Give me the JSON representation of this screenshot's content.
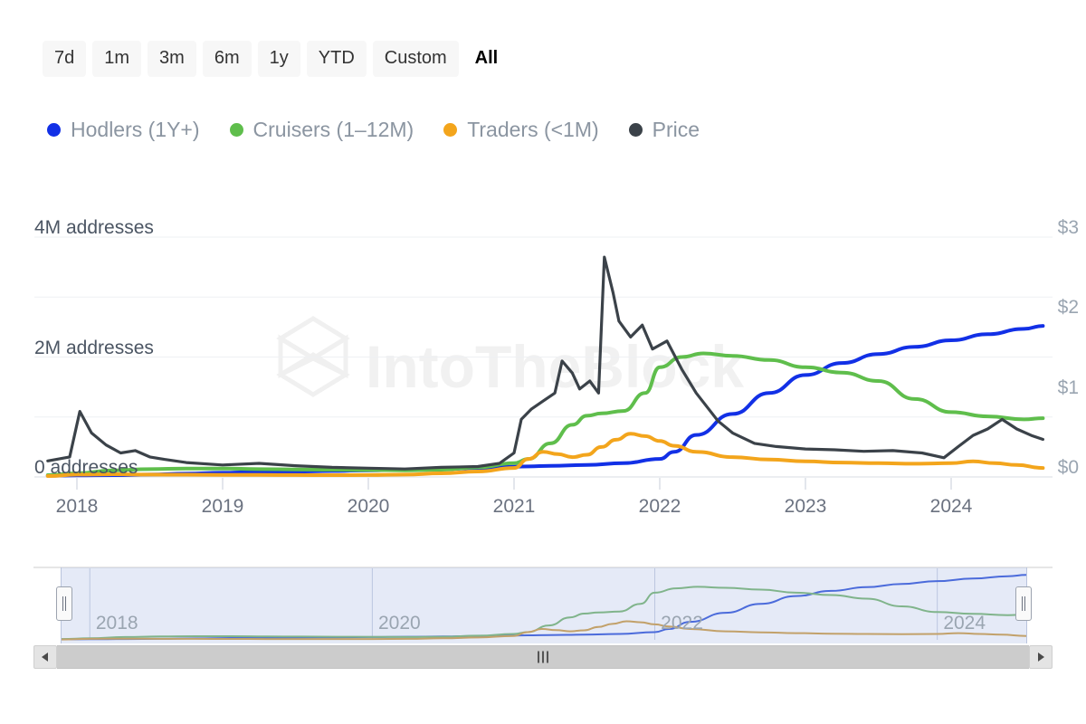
{
  "range_selector": {
    "buttons": [
      {
        "label": "7d",
        "selected": false
      },
      {
        "label": "1m",
        "selected": false
      },
      {
        "label": "3m",
        "selected": false
      },
      {
        "label": "6m",
        "selected": false
      },
      {
        "label": "1y",
        "selected": false
      },
      {
        "label": "YTD",
        "selected": false
      },
      {
        "label": "Custom",
        "selected": false
      },
      {
        "label": "All",
        "selected": true
      }
    ]
  },
  "watermark": {
    "text": "IntoTheBlock"
  },
  "navigator": {
    "year_labels": [
      "2018",
      "2020",
      "2022",
      "2024"
    ],
    "left_handle": "left-range-handle",
    "right_handle": "right-range-handle"
  },
  "scrollbar": {
    "left_arrow": "◀",
    "right_arrow": "▶",
    "grip": "|||"
  },
  "chart_data": {
    "type": "line",
    "title": "",
    "xlabel": "",
    "ylabel": "addresses",
    "y2label": "Price",
    "grid": true,
    "legend_position": "top-left",
    "x_tick_labels": [
      "2018",
      "2019",
      "2020",
      "2021",
      "2022",
      "2023",
      "2024"
    ],
    "y_tick_labels": [
      "0 addresses",
      "2M addresses",
      "4M addresses"
    ],
    "y2_tick_labels": [
      "$0",
      "$1",
      "$2",
      "$3"
    ],
    "ylim": [
      0,
      4000000
    ],
    "y2lim": [
      0,
      3
    ],
    "xlim": [
      "2017-10-01",
      "2024-08-15"
    ],
    "colors": {
      "hodlers": "#1230e6",
      "cruisers": "#5fbe4c",
      "traders": "#f3a51c",
      "price": "#3b4249"
    },
    "series": [
      {
        "name": "Hodlers (1Y+)",
        "axis": "left",
        "color": "#1230e6",
        "unit": "addresses",
        "x": [
          "2017.80",
          "2018.00",
          "2018.25",
          "2018.50",
          "2018.75",
          "2019.00",
          "2019.25",
          "2019.50",
          "2019.75",
          "2020.00",
          "2020.25",
          "2020.50",
          "2020.75",
          "2021.00",
          "2021.10",
          "2021.25",
          "2021.50",
          "2021.75",
          "2022.00",
          "2022.10",
          "2022.25",
          "2022.50",
          "2022.75",
          "2023.00",
          "2023.25",
          "2023.50",
          "2023.75",
          "2024.00",
          "2024.25",
          "2024.50",
          "2024.63"
        ],
        "values": [
          20000,
          25000,
          30000,
          40000,
          55000,
          70000,
          80000,
          90000,
          100000,
          110000,
          120000,
          130000,
          150000,
          170000,
          175000,
          185000,
          200000,
          230000,
          300000,
          420000,
          700000,
          1050000,
          1400000,
          1700000,
          1900000,
          2050000,
          2170000,
          2280000,
          2380000,
          2470000,
          2520000
        ]
      },
      {
        "name": "Cruisers (1–12M)",
        "axis": "left",
        "color": "#5fbe4c",
        "unit": "addresses",
        "x": [
          "2017.80",
          "2018.00",
          "2018.25",
          "2018.50",
          "2018.75",
          "2019.00",
          "2019.25",
          "2019.50",
          "2019.75",
          "2020.00",
          "2020.25",
          "2020.50",
          "2020.75",
          "2021.00",
          "2021.10",
          "2021.25",
          "2021.40",
          "2021.50",
          "2021.60",
          "2021.75",
          "2021.90",
          "2022.00",
          "2022.15",
          "2022.30",
          "2022.50",
          "2022.75",
          "2023.00",
          "2023.25",
          "2023.50",
          "2023.75",
          "2024.00",
          "2024.25",
          "2024.50",
          "2024.63"
        ],
        "values": [
          30000,
          60000,
          110000,
          130000,
          140000,
          140000,
          130000,
          125000,
          120000,
          115000,
          110000,
          120000,
          160000,
          230000,
          300000,
          560000,
          870000,
          1020000,
          1060000,
          1100000,
          1400000,
          1830000,
          2000000,
          2060000,
          2020000,
          1950000,
          1830000,
          1740000,
          1600000,
          1300000,
          1080000,
          1010000,
          960000,
          980000
        ]
      },
      {
        "name": "Traders (<1M)",
        "axis": "left",
        "color": "#f3a51c",
        "unit": "addresses",
        "x": [
          "2017.80",
          "2018.00",
          "2018.25",
          "2018.50",
          "2018.75",
          "2019.00",
          "2019.25",
          "2019.50",
          "2019.75",
          "2020.00",
          "2020.25",
          "2020.50",
          "2020.75",
          "2021.00",
          "2021.10",
          "2021.20",
          "2021.30",
          "2021.40",
          "2021.50",
          "2021.60",
          "2021.70",
          "2021.80",
          "2021.90",
          "2022.00",
          "2022.10",
          "2022.25",
          "2022.50",
          "2022.75",
          "2023.00",
          "2023.25",
          "2023.50",
          "2023.75",
          "2024.00",
          "2024.15",
          "2024.30",
          "2024.45",
          "2024.63"
        ],
        "values": [
          15000,
          40000,
          45000,
          40000,
          38000,
          35000,
          33000,
          32000,
          30000,
          32000,
          40000,
          60000,
          90000,
          150000,
          300000,
          420000,
          380000,
          330000,
          370000,
          500000,
          620000,
          720000,
          680000,
          600000,
          520000,
          420000,
          330000,
          290000,
          260000,
          240000,
          230000,
          220000,
          230000,
          260000,
          230000,
          200000,
          150000
        ]
      },
      {
        "name": "Price",
        "axis": "right",
        "color": "#3b4249",
        "unit": "USD",
        "x": [
          "2017.80",
          "2017.95",
          "2018.02",
          "2018.10",
          "2018.20",
          "2018.30",
          "2018.40",
          "2018.50",
          "2018.60",
          "2018.75",
          "2019.00",
          "2019.25",
          "2019.50",
          "2019.75",
          "2020.00",
          "2020.25",
          "2020.50",
          "2020.75",
          "2020.90",
          "2021.00",
          "2021.05",
          "2021.12",
          "2021.20",
          "2021.28",
          "2021.33",
          "2021.40",
          "2021.45",
          "2021.52",
          "2021.58",
          "2021.62",
          "2021.68",
          "2021.72",
          "2021.80",
          "2021.88",
          "2021.95",
          "2022.05",
          "2022.15",
          "2022.25",
          "2022.40",
          "2022.50",
          "2022.65",
          "2022.80",
          "2023.00",
          "2023.20",
          "2023.40",
          "2023.60",
          "2023.80",
          "2023.95",
          "2024.05",
          "2024.15",
          "2024.25",
          "2024.35",
          "2024.45",
          "2024.55",
          "2024.63"
        ],
        "values": [
          0.2,
          0.25,
          0.82,
          0.55,
          0.4,
          0.3,
          0.33,
          0.25,
          0.22,
          0.18,
          0.15,
          0.17,
          0.14,
          0.12,
          0.11,
          0.1,
          0.12,
          0.13,
          0.17,
          0.3,
          0.72,
          0.85,
          0.95,
          1.05,
          1.45,
          1.3,
          1.1,
          1.2,
          1.05,
          2.75,
          2.3,
          1.95,
          1.75,
          1.9,
          1.6,
          1.7,
          1.35,
          1.05,
          0.7,
          0.55,
          0.42,
          0.38,
          0.35,
          0.34,
          0.32,
          0.33,
          0.3,
          0.24,
          0.38,
          0.52,
          0.6,
          0.72,
          0.6,
          0.52,
          0.47
        ]
      }
    ]
  }
}
